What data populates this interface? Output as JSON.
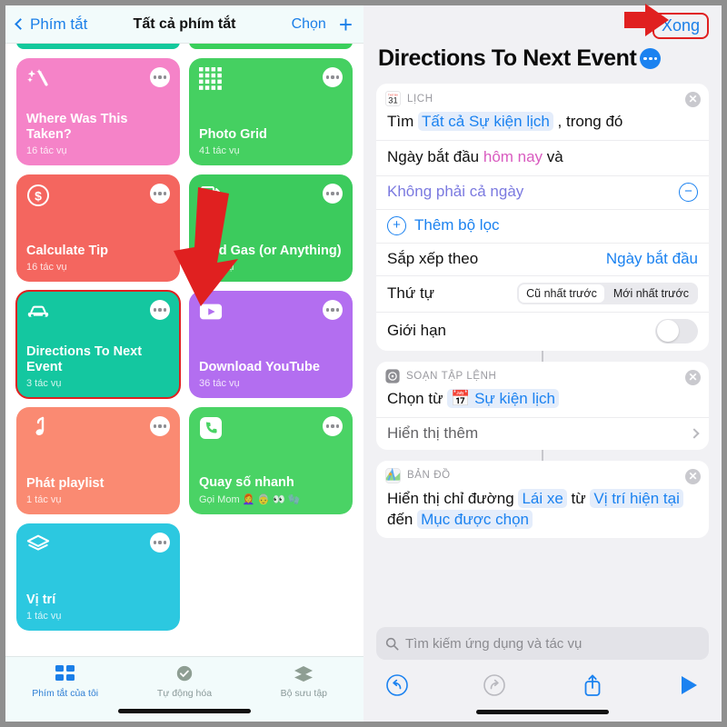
{
  "left": {
    "nav": {
      "back_label": "Phím tắt",
      "title": "Tất cả phím tắt",
      "choose_label": "Chọn",
      "add_label": "+"
    },
    "cards": [
      {
        "title": "",
        "subtitle": "",
        "color": "#12c99c",
        "icon": "",
        "stub": true,
        "selected": false
      },
      {
        "title": "",
        "subtitle": "",
        "color": "#39cf5b",
        "icon": "",
        "stub": true,
        "selected": false
      },
      {
        "title": "Where Was This Taken?",
        "subtitle": "16 tác vụ",
        "color": "#f583c8",
        "icon": "magic-wand-icon",
        "stub": false,
        "selected": false
      },
      {
        "title": "Photo Grid",
        "subtitle": "41 tác vụ",
        "color": "#45d061",
        "icon": "grid-dots-icon",
        "stub": false,
        "selected": false
      },
      {
        "title": "Calculate Tip",
        "subtitle": "16 tác vụ",
        "color": "#f4665f",
        "icon": "dollar-icon",
        "stub": false,
        "selected": false
      },
      {
        "title": "Find Gas (or Anything)",
        "subtitle": "3 tác vụ",
        "color": "#3ccb5d",
        "icon": "gas-pump-icon",
        "stub": false,
        "selected": false
      },
      {
        "title": "Directions To Next Event",
        "subtitle": "3 tác vụ",
        "color": "#14c7a0",
        "icon": "car-icon",
        "stub": false,
        "selected": true
      },
      {
        "title": "Download YouTube",
        "subtitle": "36 tác vụ",
        "color": "#b36ef0",
        "icon": "play-rect-icon",
        "stub": false,
        "selected": false
      },
      {
        "title": "Phát playlist",
        "subtitle": "1 tác vụ",
        "color": "#fa8a72",
        "icon": "music-note-icon",
        "stub": false,
        "selected": false
      },
      {
        "title": "Quay số nhanh",
        "subtitle": "Gọi Mom  👩‍🦰 👵 👀 🧤",
        "color": "#4ad365",
        "icon": "phone-icon",
        "stub": false,
        "selected": false
      },
      {
        "title": "Vị trí",
        "subtitle": "1 tác vụ",
        "color": "#2cc8e0",
        "icon": "layers-icon",
        "stub": false,
        "selected": false
      }
    ],
    "tabs": [
      {
        "label": "Phím tắt của tôi",
        "icon": "grid-squares-icon",
        "active": true
      },
      {
        "label": "Tự động hóa",
        "icon": "check-clock-icon",
        "active": false
      },
      {
        "label": "Bộ sưu tập",
        "icon": "layers-stack-icon",
        "active": false
      }
    ]
  },
  "right": {
    "done_label": "Xong",
    "title": "Directions To Next Event",
    "actions": [
      {
        "app": "LỊCH",
        "app_icon": "calendar-31-icon",
        "close_icon": "close-circle-icon",
        "rows": [
          {
            "type": "text",
            "parts": [
              {
                "t": "Tìm ",
                "style": "plain"
              },
              {
                "t": "Tất cả Sự kiện lịch",
                "style": "token"
              },
              {
                "t": " , trong đó",
                "style": "plain"
              }
            ]
          },
          {
            "type": "text",
            "parts": [
              {
                "t": "Ngày bắt đầu ",
                "style": "plain"
              },
              {
                "t": "hôm nay",
                "style": "pink"
              },
              {
                "t": " và",
                "style": "plain"
              }
            ]
          },
          {
            "type": "filter",
            "label": "Không phải cả ngày",
            "control": "minus-circle-icon"
          },
          {
            "type": "add",
            "label": "Thêm bộ lọc",
            "control": "plus-circle-icon"
          },
          {
            "type": "kv",
            "label": "Sắp xếp theo",
            "value": "Ngày bắt đầu"
          },
          {
            "type": "segmented",
            "label": "Thứ tự",
            "options": [
              "Cũ nhất trước",
              "Mới nhất trước"
            ],
            "selected": 0
          },
          {
            "type": "toggle",
            "label": "Giới hạn",
            "on": false
          }
        ]
      },
      {
        "app": "SOẠN TẬP LỆNH",
        "app_icon": "shortcuts-gear-icon",
        "close_icon": "close-circle-icon",
        "rows": [
          {
            "type": "text",
            "parts": [
              {
                "t": "Chọn từ ",
                "style": "plain"
              },
              {
                "t": "📅 Sự kiện lịch",
                "style": "token"
              }
            ]
          },
          {
            "type": "disclosure",
            "label": "Hiển thị thêm",
            "control": "chevron-right-icon"
          }
        ]
      },
      {
        "app": "BẢN ĐỒ",
        "app_icon": "maps-icon",
        "close_icon": "close-circle-icon",
        "rows": [
          {
            "type": "text",
            "parts": [
              {
                "t": "Hiển thị chỉ đường ",
                "style": "plain"
              },
              {
                "t": "Lái xe",
                "style": "token"
              },
              {
                "t": " từ ",
                "style": "plain"
              },
              {
                "t": "Vị trí hiện tại",
                "style": "token"
              },
              {
                "t": " đến ",
                "style": "plain"
              },
              {
                "t": "Mục được chọn",
                "style": "token"
              }
            ]
          }
        ]
      }
    ],
    "search": {
      "placeholder": "Tìm kiếm ứng dụng và tác vụ",
      "icon": "search-icon"
    },
    "toolbar": [
      {
        "name": "undo-button",
        "icon": "undo-icon",
        "enabled": true
      },
      {
        "name": "redo-button",
        "icon": "redo-icon",
        "enabled": false
      },
      {
        "name": "share-button",
        "icon": "share-icon",
        "enabled": true
      },
      {
        "name": "run-button",
        "icon": "play-icon",
        "enabled": true
      }
    ]
  },
  "annotations": {
    "arrow_color": "#e02020",
    "arrow_right_target": "Xong",
    "arrow_down_target": "Directions To Next Event card"
  }
}
